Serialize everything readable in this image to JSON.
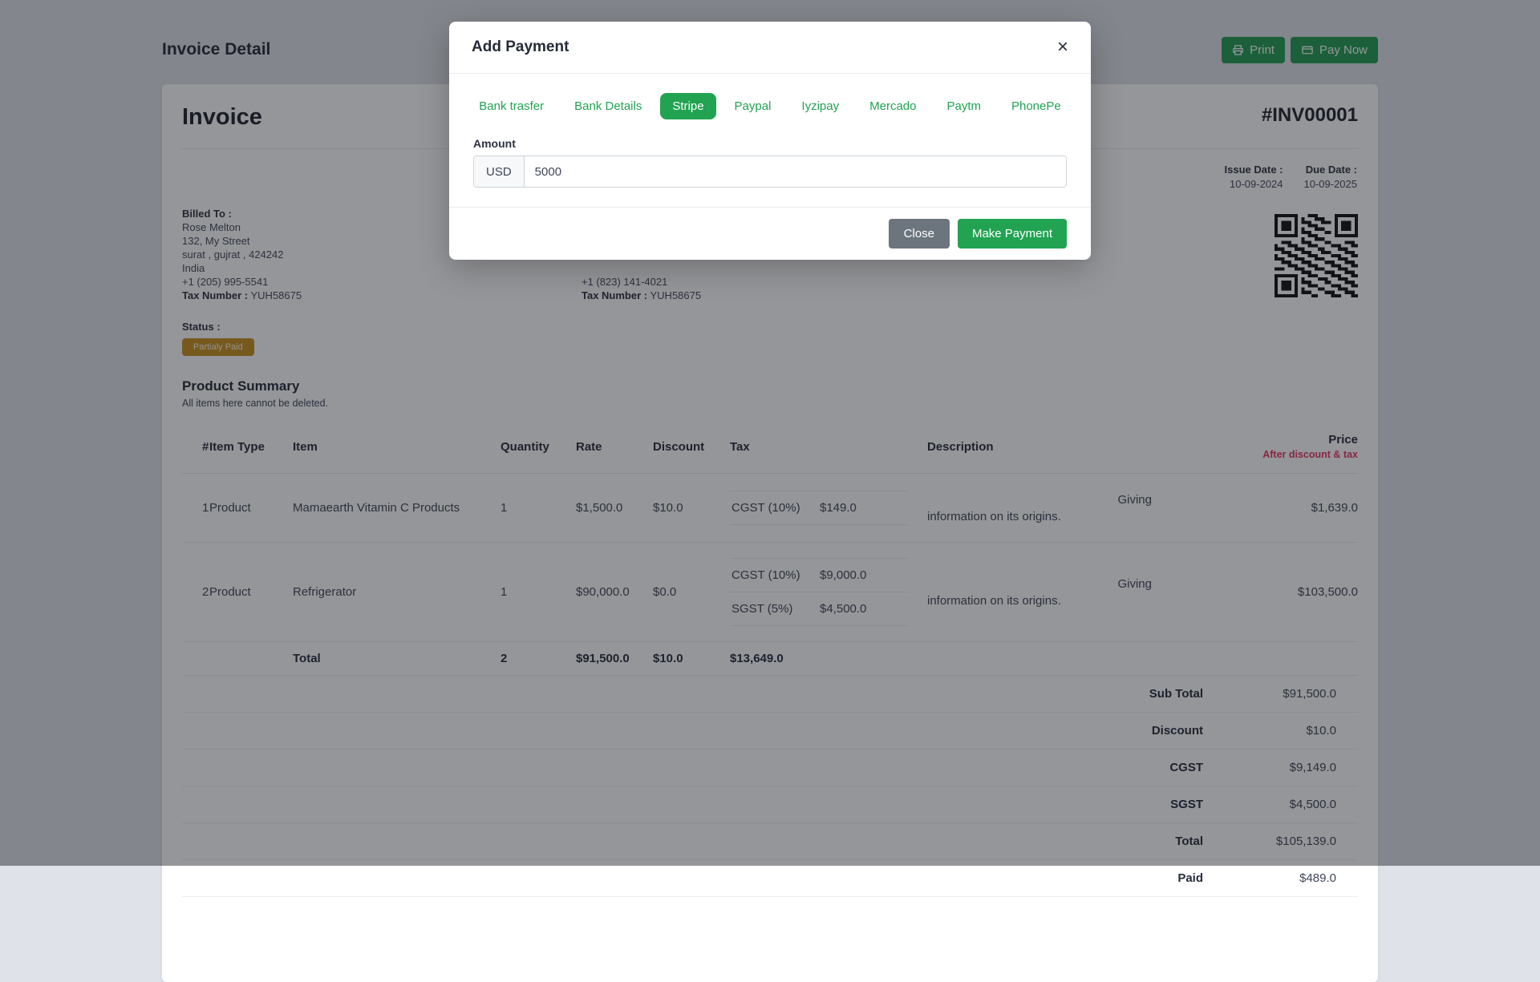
{
  "page": {
    "title": "Invoice Detail"
  },
  "topbar": {
    "print_label": "Print",
    "pay_now_label": "Pay Now"
  },
  "invoice": {
    "heading": "Invoice",
    "number": "#INV00001",
    "issue_date_label": "Issue Date :",
    "issue_date_value": "10-09-2024",
    "due_date_label": "Due Date :",
    "due_date_value": "10-09-2025",
    "billed_to": {
      "label": "Billed To :",
      "name": "Rose Melton",
      "street": "132, My Street",
      "city_line": "surat , gujrat , 424242",
      "country": "India",
      "phone": "+1 (205) 995-5541",
      "tax_label": "Tax Number :",
      "tax_value": "YUH58675"
    },
    "second_party": {
      "phone": "+1 (823) 141-4021",
      "tax_label": "Tax Number :",
      "tax_value": "YUH58675"
    },
    "status_label": "Status :",
    "status_badge": "Partialy Paid"
  },
  "product_summary": {
    "title": "Product Summary",
    "subtitle": "All items here cannot be deleted.",
    "columns": {
      "num": "#",
      "item_type": "Item Type",
      "item": "Item",
      "quantity": "Quantity",
      "rate": "Rate",
      "discount": "Discount",
      "tax": "Tax",
      "description": "Description",
      "price": "Price",
      "price_note": "After discount & tax"
    },
    "rows": [
      {
        "num": "1",
        "item_type": "Product",
        "item": "Mamaearth Vitamin C Products",
        "quantity": "1",
        "rate": "$1,500.0",
        "discount": "$10.0",
        "taxes": [
          {
            "label": "CGST (10%)",
            "value": "$149.0"
          }
        ],
        "description_line1": "Giving",
        "description_line2": "information on its origins.",
        "price": "$1,639.0"
      },
      {
        "num": "2",
        "item_type": "Product",
        "item": "Refrigerator",
        "quantity": "1",
        "rate": "$90,000.0",
        "discount": "$0.0",
        "taxes": [
          {
            "label": "CGST (10%)",
            "value": "$9,000.0"
          },
          {
            "label": "SGST (5%)",
            "value": "$4,500.0"
          }
        ],
        "description_line1": "Giving",
        "description_line2": "information on its origins.",
        "price": "$103,500.0"
      }
    ],
    "total_row": {
      "label": "Total",
      "quantity": "2",
      "rate": "$91,500.0",
      "discount": "$10.0",
      "tax": "$13,649.0"
    },
    "summary": [
      {
        "label": "Sub Total",
        "value": "$91,500.0"
      },
      {
        "label": "Discount",
        "value": "$10.0"
      },
      {
        "label": "CGST",
        "value": "$9,149.0"
      },
      {
        "label": "SGST",
        "value": "$4,500.0"
      },
      {
        "label": "Total",
        "value": "$105,139.0"
      },
      {
        "label": "Paid",
        "value": "$489.0"
      }
    ]
  },
  "modal": {
    "title": "Add Payment",
    "close_glyph": "×",
    "tabs": [
      {
        "label": "Bank trasfer"
      },
      {
        "label": "Bank Details"
      },
      {
        "label": "Stripe"
      },
      {
        "label": "Paypal"
      },
      {
        "label": "Iyzipay"
      },
      {
        "label": "Mercado"
      },
      {
        "label": "Paytm"
      },
      {
        "label": "PhonePe"
      }
    ],
    "amount_label": "Amount",
    "currency": "USD",
    "amount_value": "5000",
    "close_button": "Close",
    "make_payment_button": "Make Payment"
  },
  "colors": {
    "accent_green": "#21a352",
    "badge_orange": "#c8901e",
    "price_note_red": "#e5365f",
    "secondary_gray": "#6c757d"
  }
}
